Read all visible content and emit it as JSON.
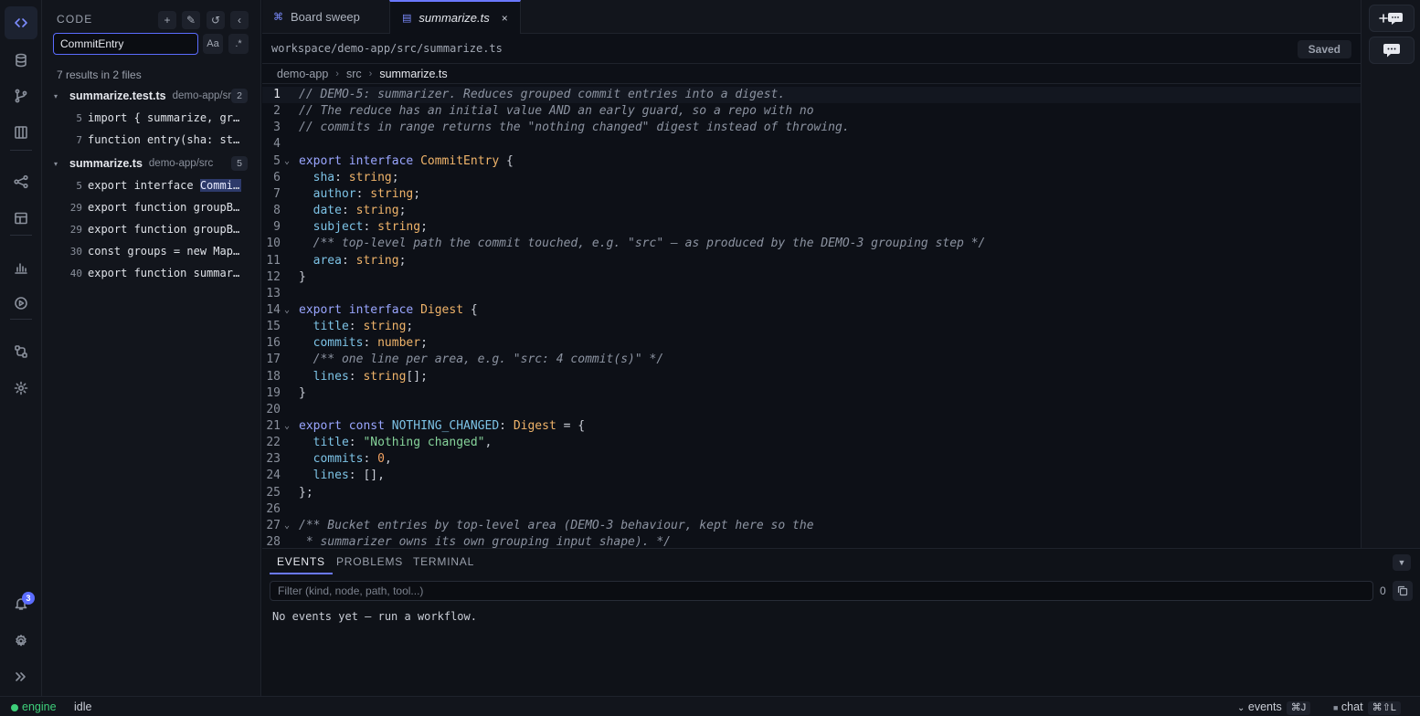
{
  "activity": {
    "items": [
      {
        "icon": "code-icon",
        "active": true
      },
      {
        "icon": "database-icon"
      },
      {
        "icon": "git-branch-icon"
      },
      {
        "icon": "board-icon"
      },
      {
        "icon": "share-nodes-icon"
      },
      {
        "icon": "layout-icon"
      },
      {
        "icon": "chart-icon"
      },
      {
        "icon": "play-icon"
      },
      {
        "icon": "workflow-icon"
      },
      {
        "icon": "settings-cog-icon"
      }
    ],
    "notifications_count": "3"
  },
  "sidebar": {
    "title": "CODE",
    "search_value": "CommitEntry",
    "match_case_label": "Aa",
    "regex_label": ".*",
    "results_summary": "7 results in 2 files",
    "files": [
      {
        "name": "summarize.test.ts",
        "path": "demo-app/src",
        "count": "2",
        "matches": [
          {
            "line": "5",
            "text": "import { summarize, groupByArea, NOTHING_CHANGED, type CommitEntry } from './summarize';"
          },
          {
            "line": "7",
            "text": "function entry(sha: string, area: string): CommitEntry {"
          }
        ]
      },
      {
        "name": "summarize.ts",
        "path": "demo-app/src",
        "count": "5",
        "matches": [
          {
            "line": "5",
            "pre": "export interface ",
            "hit": "CommitEntry",
            "post": " {"
          },
          {
            "line": "29",
            "text": "export function groupByArea(entries: CommitEntry[]) {"
          },
          {
            "line": "29",
            "text": "export function groupByArea(entries: CommitEntry[]) {"
          },
          {
            "line": "30",
            "text": "const groups = new Map<string, CommitEntry[]>();"
          },
          {
            "line": "40",
            "text": "export function summarize(entries: CommitEntry[]): Digest {"
          }
        ]
      }
    ]
  },
  "tabs": [
    {
      "label": "Board sweep",
      "icon": "⌘",
      "active": false
    },
    {
      "label": "summarize.ts",
      "icon": "▤",
      "active": true,
      "close": "×"
    }
  ],
  "editor": {
    "path": "workspace/demo-app/src/summarize.ts",
    "status": "Saved",
    "breadcrumbs": [
      "demo-app",
      "src",
      "summarize.ts"
    ],
    "current_line": 1,
    "lines": [
      [
        [
          "c",
          "// DEMO-5: summarizer. Reduces grouped commit entries into a digest."
        ]
      ],
      [
        [
          "c",
          "// The reduce has an initial value AND an early guard, so a repo with no"
        ]
      ],
      [
        [
          "c",
          "// commits in range returns the \"nothing changed\" digest instead of throwing."
        ]
      ],
      [],
      [
        [
          "k",
          "export"
        ],
        [
          "pu",
          " "
        ],
        [
          "k",
          "interface"
        ],
        [
          "pu",
          " "
        ],
        [
          "tn",
          "CommitEntry"
        ],
        [
          "pu",
          " {"
        ]
      ],
      [
        [
          "pu",
          "  "
        ],
        [
          "p",
          "sha"
        ],
        [
          "pu",
          ": "
        ],
        [
          "tn",
          "string"
        ],
        [
          "pu",
          ";"
        ]
      ],
      [
        [
          "pu",
          "  "
        ],
        [
          "p",
          "author"
        ],
        [
          "pu",
          ": "
        ],
        [
          "tn",
          "string"
        ],
        [
          "pu",
          ";"
        ]
      ],
      [
        [
          "pu",
          "  "
        ],
        [
          "p",
          "date"
        ],
        [
          "pu",
          ": "
        ],
        [
          "tn",
          "string"
        ],
        [
          "pu",
          ";"
        ]
      ],
      [
        [
          "pu",
          "  "
        ],
        [
          "p",
          "subject"
        ],
        [
          "pu",
          ": "
        ],
        [
          "tn",
          "string"
        ],
        [
          "pu",
          ";"
        ]
      ],
      [
        [
          "pu",
          "  "
        ],
        [
          "c",
          "/** top-level path the commit touched, e.g. \"src\" — as produced by the DEMO-3 grouping step */"
        ]
      ],
      [
        [
          "pu",
          "  "
        ],
        [
          "p",
          "area"
        ],
        [
          "pu",
          ": "
        ],
        [
          "tn",
          "string"
        ],
        [
          "pu",
          ";"
        ]
      ],
      [
        [
          "pu",
          "}"
        ]
      ],
      [],
      [
        [
          "k",
          "export"
        ],
        [
          "pu",
          " "
        ],
        [
          "k",
          "interface"
        ],
        [
          "pu",
          " "
        ],
        [
          "tn",
          "Digest"
        ],
        [
          "pu",
          " {"
        ]
      ],
      [
        [
          "pu",
          "  "
        ],
        [
          "p",
          "title"
        ],
        [
          "pu",
          ": "
        ],
        [
          "tn",
          "string"
        ],
        [
          "pu",
          ";"
        ]
      ],
      [
        [
          "pu",
          "  "
        ],
        [
          "p",
          "commits"
        ],
        [
          "pu",
          ": "
        ],
        [
          "tn",
          "number"
        ],
        [
          "pu",
          ";"
        ]
      ],
      [
        [
          "pu",
          "  "
        ],
        [
          "c",
          "/** one line per area, e.g. \"src: 4 commit(s)\" */"
        ]
      ],
      [
        [
          "pu",
          "  "
        ],
        [
          "p",
          "lines"
        ],
        [
          "pu",
          ": "
        ],
        [
          "tn",
          "string"
        ],
        [
          "pu",
          "[];"
        ]
      ],
      [
        [
          "pu",
          "}"
        ]
      ],
      [],
      [
        [
          "k",
          "export"
        ],
        [
          "pu",
          " "
        ],
        [
          "k",
          "const"
        ],
        [
          "pu",
          " "
        ],
        [
          "p",
          "NOTHING_CHANGED"
        ],
        [
          "pu",
          ": "
        ],
        [
          "tn",
          "Digest"
        ],
        [
          "pu",
          " = {"
        ]
      ],
      [
        [
          "pu",
          "  "
        ],
        [
          "p",
          "title"
        ],
        [
          "pu",
          ": "
        ],
        [
          "s",
          "\"Nothing changed\""
        ],
        [
          "pu",
          ","
        ]
      ],
      [
        [
          "pu",
          "  "
        ],
        [
          "p",
          "commits"
        ],
        [
          "pu",
          ": "
        ],
        [
          "n",
          "0"
        ],
        [
          "pu",
          ","
        ]
      ],
      [
        [
          "pu",
          "  "
        ],
        [
          "p",
          "lines"
        ],
        [
          "pu",
          ": [],"
        ]
      ],
      [
        [
          "pu",
          "};"
        ]
      ],
      [],
      [
        [
          "c",
          "/** Bucket entries by top-level area (DEMO-3 behaviour, kept here so the"
        ]
      ],
      [
        [
          "c",
          " * summarizer owns its own grouping input shape). */"
        ]
      ]
    ],
    "fold_lines": [
      5,
      14,
      21,
      27
    ],
    "fold_glyph": "⌄"
  },
  "panel": {
    "tabs": [
      "EVENTS",
      "PROBLEMS",
      "TERMINAL"
    ],
    "active_tab": "EVENTS",
    "filter_placeholder": "Filter (kind, node, path, tool...)",
    "event_count": "0",
    "empty_message": "No events yet — run a workflow."
  },
  "status": {
    "engine_label": "engine",
    "engine_state": "idle",
    "events_label": "events",
    "events_shortcut": "⌘J",
    "chat_label": "chat",
    "chat_shortcut": "⌘⇧L"
  },
  "colors": {
    "accent": "#6a78ff",
    "engine_ok": "#3ecf7a"
  }
}
